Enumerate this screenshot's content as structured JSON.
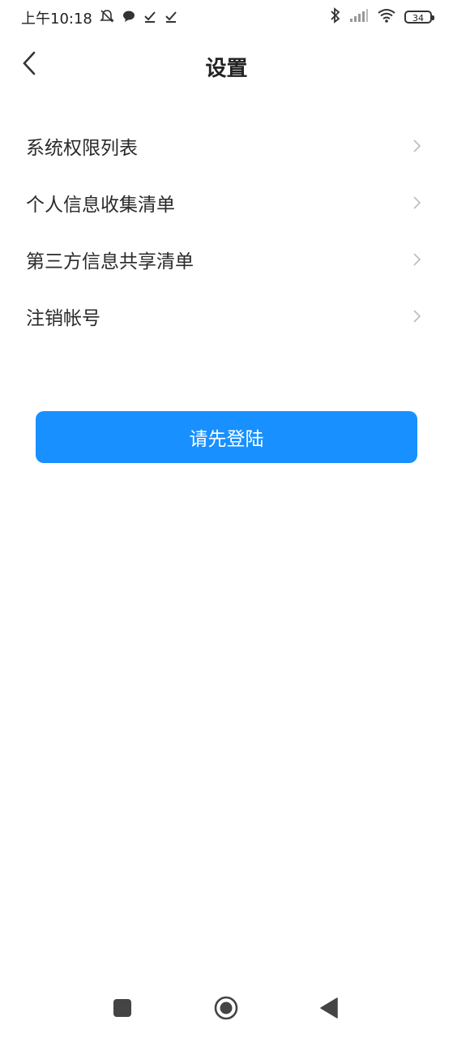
{
  "status_bar": {
    "time": "上午10:18",
    "battery": "34",
    "icons": [
      "mute-icon",
      "message-icon",
      "check-icon",
      "check-icon",
      "bluetooth-icon",
      "signal-icon",
      "wifi-icon",
      "battery-icon"
    ]
  },
  "header": {
    "title": "设置",
    "back_icon": "chevron-left-icon"
  },
  "menu": {
    "items": [
      {
        "label": "系统权限列表"
      },
      {
        "label": "个人信息收集清单"
      },
      {
        "label": "第三方信息共享清单"
      },
      {
        "label": "注销帐号"
      }
    ]
  },
  "login_button": {
    "label": "请先登陆",
    "color": "#1890ff"
  },
  "nav_bar": {
    "icons": [
      "recent-apps-icon",
      "home-icon",
      "back-triangle-icon"
    ]
  }
}
